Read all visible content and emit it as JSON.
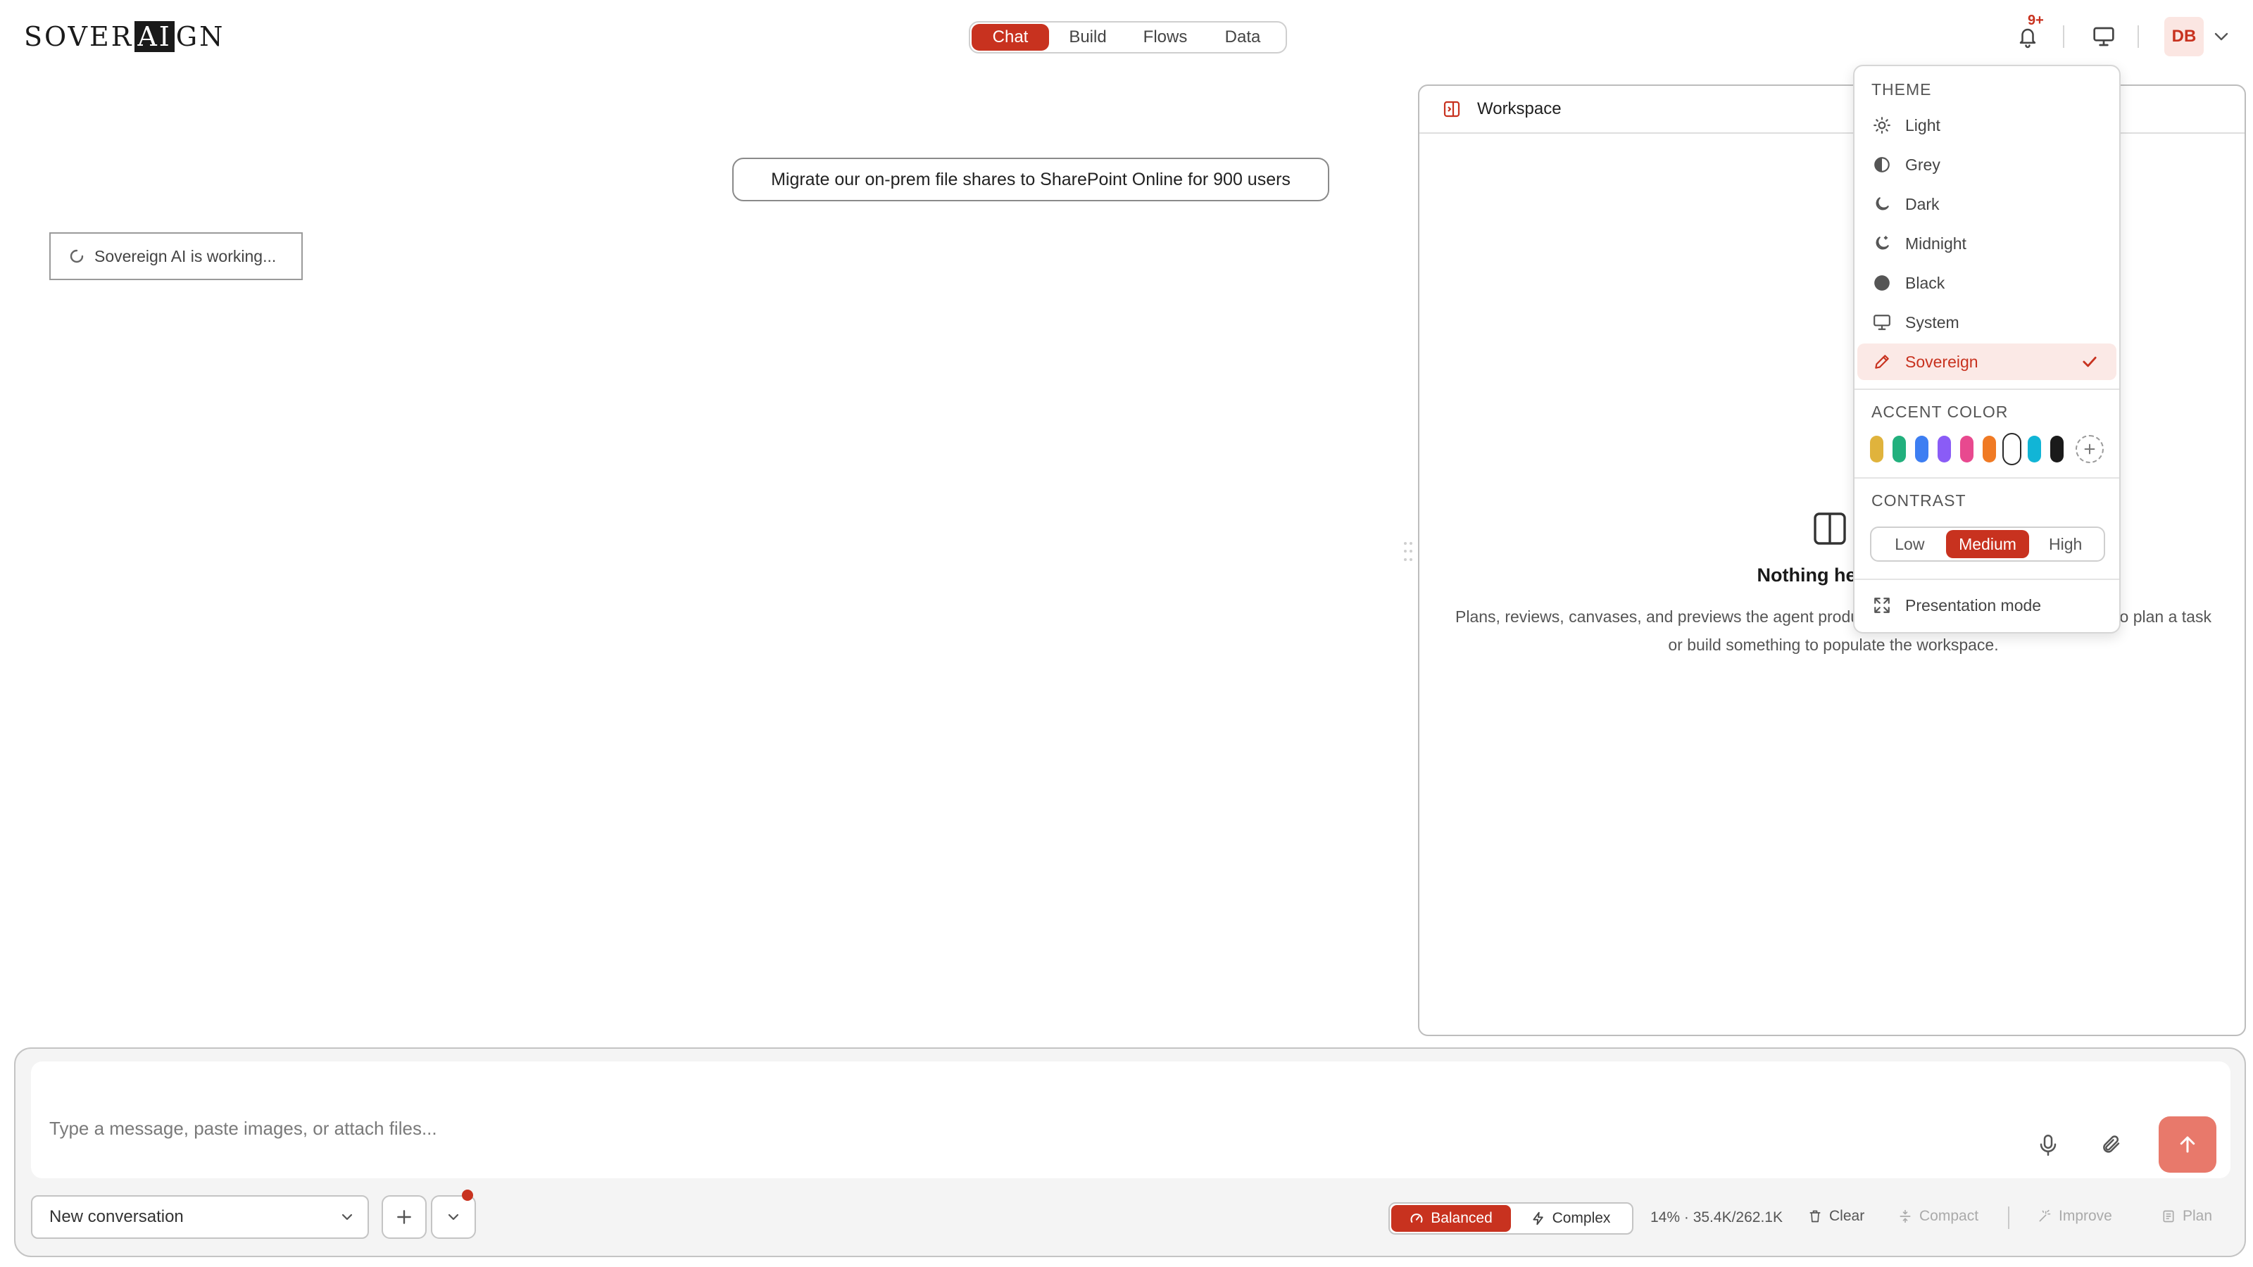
{
  "brand": {
    "logo_pre": "SOVER",
    "logo_ai": "AI",
    "logo_post": "GN"
  },
  "nav": {
    "tabs": [
      {
        "label": "Chat",
        "active": true
      },
      {
        "label": "Build",
        "active": false
      },
      {
        "label": "Flows",
        "active": false
      },
      {
        "label": "Data",
        "active": false
      }
    ]
  },
  "header": {
    "notifications_badge": "9+",
    "bell_icon": "bell-icon",
    "display_icon": "monitor-icon",
    "avatar_initials": "DB"
  },
  "chat": {
    "user_message": "Migrate our on-prem file shares to SharePoint Online for 900 users",
    "status_text": "Sovereign AI is working..."
  },
  "workspace": {
    "title": "Workspace",
    "empty_title": "Nothing here yet",
    "empty_desc": "Plans, reviews, canvases, and previews the agent produces will appear here. Ask the agent to plan a task or build something to populate the workspace."
  },
  "theme_menu": {
    "theme_heading": "THEME",
    "themes": [
      {
        "label": "Light",
        "icon": "sun-icon",
        "selected": false
      },
      {
        "label": "Grey",
        "icon": "half-circle-icon",
        "selected": false
      },
      {
        "label": "Dark",
        "icon": "moon-icon",
        "selected": false
      },
      {
        "label": "Midnight",
        "icon": "moon-stars-icon",
        "selected": false
      },
      {
        "label": "Black",
        "icon": "filled-circle-icon",
        "selected": false
      },
      {
        "label": "System",
        "icon": "monitor-icon",
        "selected": false
      },
      {
        "label": "Sovereign",
        "icon": "pen-icon",
        "selected": true
      }
    ],
    "accent_heading": "ACCENT COLOR",
    "accent_colors": [
      "#e0b33c",
      "#22b07d",
      "#3d7ef2",
      "#8a5cf6",
      "#e8498f",
      "#f07a24",
      "#ffffff",
      "#11b5d6",
      "#1a1a1a"
    ],
    "accent_selected_index": 6,
    "contrast_heading": "CONTRAST",
    "contrast_options": [
      {
        "label": "Low",
        "active": false
      },
      {
        "label": "Medium",
        "active": true
      },
      {
        "label": "High",
        "active": false
      }
    ],
    "presentation_label": "Presentation mode"
  },
  "composer": {
    "placeholder": "Type a message, paste images, or attach files...",
    "conversation_select": "New conversation",
    "mode_balanced": "Balanced",
    "mode_complex": "Complex",
    "usage": "14% · 35.4K/262.1K",
    "clear": "Clear",
    "compact": "Compact",
    "improve": "Improve",
    "plan": "Plan"
  },
  "colors": {
    "accent": "#c8321f",
    "accent_soft": "#fbe9e6",
    "send": "#e8796b"
  }
}
